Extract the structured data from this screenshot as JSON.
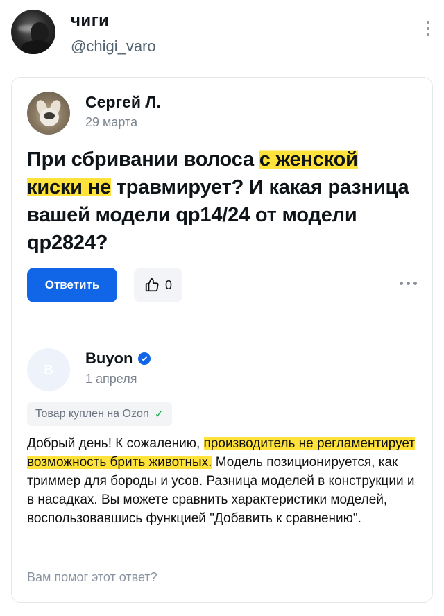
{
  "tweet": {
    "display_name": "чиги",
    "handle": "@chigi_varo",
    "avatar_icon": "user-avatar-smoking-photo",
    "more_icon": "vertical-ellipsis-icon"
  },
  "question": {
    "author": "Сергей Л.",
    "date": "29 марта",
    "avatar_icon": "dog-photo-avatar",
    "text_parts": {
      "p1": "При сбривании волоса ",
      "p2_highlight": "с женской",
      "p3_newline": " ",
      "p4_highlight": "киски не",
      "p5": " травмирует? И какая разница вашей модели qp14/24 от модели qp2824?"
    },
    "reply_label": "Ответить",
    "like_count": "0",
    "like_icon": "thumbs-up-icon",
    "more_icon": "horizontal-ellipsis-icon"
  },
  "answer": {
    "author": "Buyon",
    "avatar_letter": "B",
    "verified_icon": "verified-check-icon",
    "date": "1 апреля",
    "purchase_badge": "Товар куплен на Ozon",
    "purchase_check_icon": "checkmark-icon",
    "text_parts": {
      "p1": "Добрый день! К сожалению, ",
      "p2_highlight": "производитель не регламентирует возможность брить животных.",
      "p3": " Модель позиционируется, как триммер для бороды и усов. Разница моделей в конструкции и в насадках. Вы можете сравнить характеристики моделей, воспользовавшись функцией \"Добавить к сравнению\"."
    },
    "helpful_prompt": "Вам помог этот ответ?"
  },
  "colors": {
    "highlight": "#ffe23a",
    "primary_blue": "#1166e8",
    "muted_text": "#7c8490",
    "check_green": "#12a84a"
  }
}
